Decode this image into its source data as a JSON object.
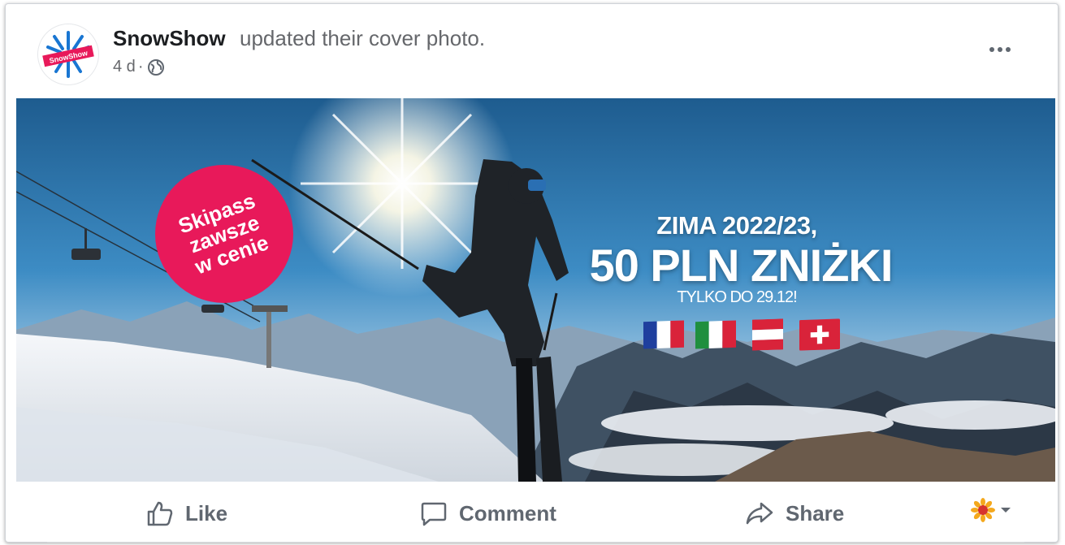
{
  "post": {
    "page_name": "SnowShow",
    "action_text": "updated their cover photo.",
    "time": "4 d",
    "separator": "·",
    "avatar_text": "SnowShow",
    "privacy_icon": "globe-icon",
    "more_icon": "more-horizontal-icon"
  },
  "cover": {
    "badge_text": "Skipass\nzawsze\nw cenie",
    "headline_1": "ZIMA 2022/23,",
    "headline_2": "50 PLN ZNIŻKI",
    "subline": "TYLKO DO 29.12!",
    "flags": [
      "France",
      "Italy",
      "Austria",
      "Switzerland"
    ]
  },
  "actions": {
    "like_label": "Like",
    "comment_label": "Comment",
    "share_label": "Share",
    "like_icon": "thumbs-up-icon",
    "comment_icon": "speech-bubble-icon",
    "share_icon": "share-arrow-icon",
    "reaction_icon": "sunflower-icon",
    "dropdown_icon": "chevron-down-icon"
  },
  "colors": {
    "badge": "#e8195a",
    "text_secondary": "#606770",
    "sky_top": "#1e5c8f"
  }
}
